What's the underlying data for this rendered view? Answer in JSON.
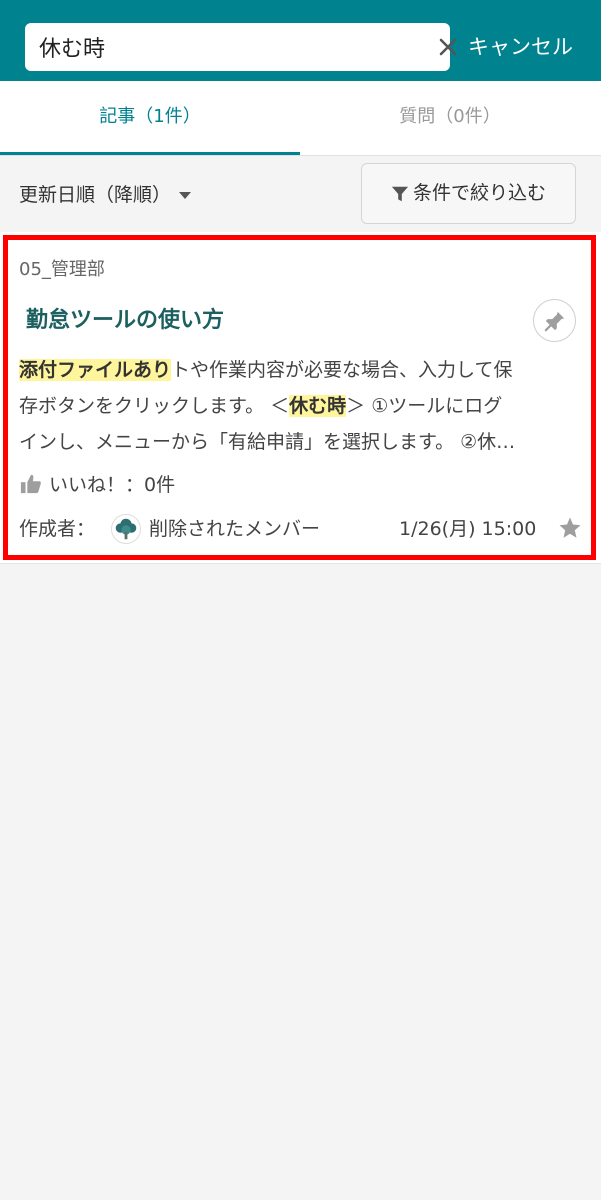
{
  "search": {
    "value": "休む時",
    "cancel_label": "キャンセル"
  },
  "tabs": [
    {
      "label": "記事（1件）",
      "active": true
    },
    {
      "label": "質問（0件）",
      "active": false
    }
  ],
  "toolbar": {
    "sort_label": "更新日順（降順）",
    "filter_label": "条件で絞り込む"
  },
  "article": {
    "category": "05_管理部",
    "title": "勤怠ツールの使い方",
    "excerpt": {
      "line1_hl": "添付ファイルあり",
      "line1_rest": "トや作業内容が必要な場合、入力して保",
      "line2_pre": "存ボタンをクリックします。 ＜",
      "line2_hl": "休む時",
      "line2_post": "＞ ①ツールにログ",
      "line3": "インし、メニューから「有給申請」を選択します。 ②休…"
    },
    "likes_label": "いいね！：0件",
    "author_label": "作成者：",
    "author_name": "削除されたメンバー",
    "date": "1/26(月) 15:00"
  },
  "colors": {
    "header": "#00838f",
    "active_tab": "#00838f",
    "title": "#1b5f5f",
    "highlight": "#fff59d",
    "frame": "#ff0000"
  }
}
